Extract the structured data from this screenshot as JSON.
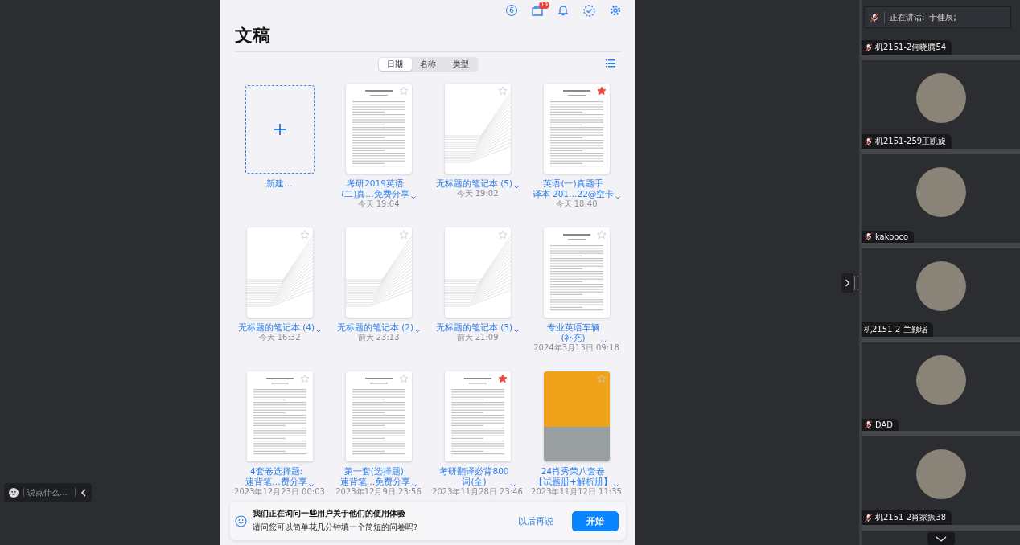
{
  "toolbar": {
    "counter": "6",
    "inbox_badge": "19"
  },
  "title": "文稿",
  "sort_tabs": [
    {
      "label": "日期",
      "selected": true
    },
    {
      "label": "名称",
      "selected": false
    },
    {
      "label": "类型",
      "selected": false
    }
  ],
  "documents": [
    {
      "kind": "new",
      "title_lines": [
        "新建..."
      ]
    },
    {
      "kind": "document",
      "title_lines": [
        "考研2019英语",
        "(二)真…免费分享"
      ],
      "date": "今天 19:04",
      "starred": false
    },
    {
      "kind": "notebook",
      "title_lines": [
        "无标题的笔记本 (5)"
      ],
      "date": "今天 19:02",
      "starred": false
    },
    {
      "kind": "document",
      "title_lines": [
        "英语(一)真题手",
        "译本 201…22@空卡"
      ],
      "date": "今天 18:40",
      "starred": true
    },
    {
      "kind": "notebook",
      "title_lines": [
        "无标题的笔记本 (4)"
      ],
      "date": "今天 16:32",
      "starred": false
    },
    {
      "kind": "notebook",
      "title_lines": [
        "无标题的笔记本 (2)"
      ],
      "date": "前天 23:13",
      "starred": false
    },
    {
      "kind": "notebook",
      "title_lines": [
        "无标题的笔记本 (3)"
      ],
      "date": "前天 21:09",
      "starred": false
    },
    {
      "kind": "document",
      "title_lines": [
        "专业英语车辆",
        "(补充)"
      ],
      "date": "2024年3月13日 09:18",
      "starred": false
    },
    {
      "kind": "document",
      "title_lines": [
        "4套卷选择题:",
        "速背笔…费分享"
      ],
      "date": "2023年12月23日 00:03",
      "starred": false
    },
    {
      "kind": "document",
      "title_lines": [
        "第一套(选择题):",
        "速背笔…免费分享"
      ],
      "date": "2023年12月9日 23:56",
      "starred": false
    },
    {
      "kind": "document",
      "title_lines": [
        "考研翻译必背800",
        "词(全)"
      ],
      "date": "2023年11月28日 23:46",
      "starred": true
    },
    {
      "kind": "cover",
      "title_lines": [
        "24肖秀荣八套卷",
        "【试题册+解析册】"
      ],
      "date": "2023年11月12日 11:35",
      "starred": false
    }
  ],
  "survey": {
    "heading": "我们正在询问一些用户关于他们的使用体验",
    "question": "请问您可以简单花几分钟填一个简短的问卷吗?",
    "later": "以后再说",
    "start": "开始"
  },
  "chat": {
    "placeholder": "说点什么..."
  },
  "speaking": {
    "label": "正在讲话:",
    "names": "于佳辰;"
  },
  "participants": [
    {
      "name": "机2151-2何晓腾54",
      "muted": true,
      "avatar": false
    },
    {
      "name": "机2151-259王凯旋",
      "muted": true,
      "avatar": true
    },
    {
      "name": "kakooco",
      "muted": true,
      "avatar": true
    },
    {
      "name": "机2151-2 兰颢琚",
      "muted": false,
      "avatar": true
    },
    {
      "name": "DAD",
      "muted": true,
      "avatar": true
    },
    {
      "name": "机2151-2肖家振38",
      "muted": true,
      "avatar": true
    }
  ]
}
